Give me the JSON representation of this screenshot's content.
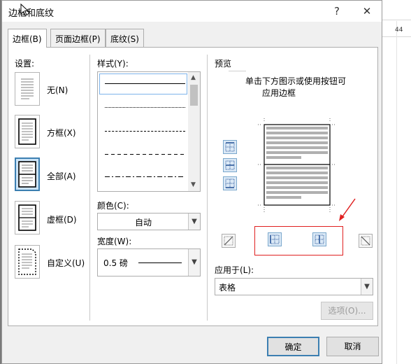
{
  "window": {
    "title": "边框和底纹",
    "help_glyph": "?",
    "close_glyph": "✕"
  },
  "tabs": [
    {
      "label": "边框(B)",
      "active": true
    },
    {
      "label": "页面边框(P)",
      "active": false
    },
    {
      "label": "底纹(S)",
      "active": false
    }
  ],
  "settings": {
    "label": "设置:",
    "items": [
      {
        "label": "无(N)",
        "icon": "border-none-icon"
      },
      {
        "label": "方框(X)",
        "icon": "border-box-icon"
      },
      {
        "label": "全部(A)",
        "icon": "border-all-icon",
        "selected": true
      },
      {
        "label": "虚框(D)",
        "icon": "border-grid-icon"
      },
      {
        "label": "自定义(U)",
        "icon": "border-custom-icon"
      }
    ]
  },
  "style": {
    "label": "样式(Y):",
    "lines": [
      "solid",
      "dotted",
      "dense-dashed",
      "dashed",
      "dash-dot"
    ]
  },
  "color": {
    "label": "颜色(C):",
    "value": "自动"
  },
  "width": {
    "label": "宽度(W):",
    "value": "0.5 磅"
  },
  "preview": {
    "label": "预览",
    "hint_line1": "单击下方图示或使用按钮可",
    "hint_line2": "应用边框",
    "annotation_color": "#e02020"
  },
  "apply_to": {
    "label": "应用于(L):",
    "value": "表格"
  },
  "buttons": {
    "options": "选项(O)...",
    "ok": "确定",
    "cancel": "取消"
  },
  "background_doc": {
    "number": "44"
  }
}
